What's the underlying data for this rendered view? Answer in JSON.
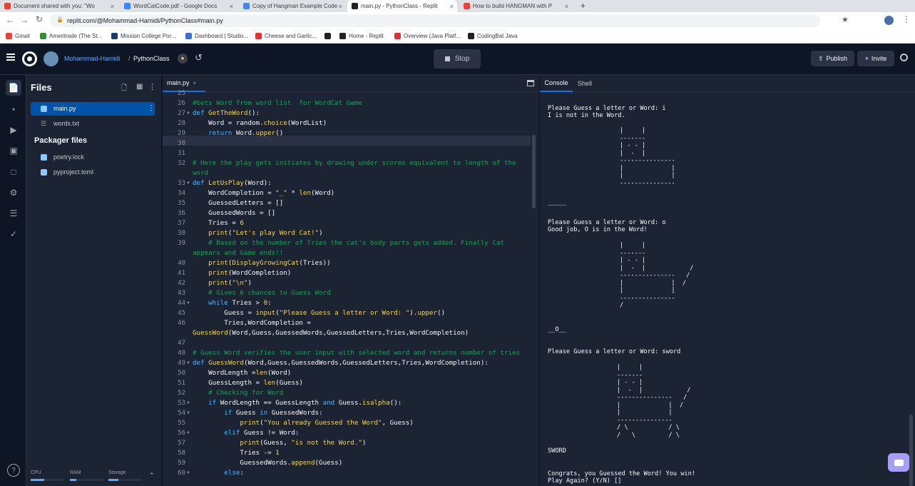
{
  "browser": {
    "tabs": [
      {
        "label": "Document shared with you: \"Wo",
        "color": "#ea4335"
      },
      {
        "label": "WordCatCode.pdf - Google Docs",
        "color": "#4285f4"
      },
      {
        "label": "Copy of Hangman Example Code",
        "color": "#4285f4"
      },
      {
        "label": "main.py - PythonClass - Replit",
        "color": "#222"
      },
      {
        "label": "How to build HANGMAN with P",
        "color": "#ea4335"
      }
    ],
    "new_tab": "+",
    "url": "replit.com/@Mohammad-Hamidi/PythonClass#main.py",
    "bookmarks": [
      {
        "label": "Gmail",
        "color": "#ea4335"
      },
      {
        "label": "Ameritrade (The St...",
        "color": "#3a8a3a"
      },
      {
        "label": "Mission College Por...",
        "color": "#1a3a6e"
      },
      {
        "label": "Dashboard | Studio...",
        "color": "#3b6fd0"
      },
      {
        "label": "Cheese and Garlic...",
        "color": "#d33"
      },
      {
        "label": "",
        "color": "#222"
      },
      {
        "label": "Home - Replit",
        "color": "#222"
      },
      {
        "label": "Overview (Java Platf...",
        "color": "#d33"
      },
      {
        "label": "CodingBat Java",
        "color": "#222"
      }
    ]
  },
  "replit": {
    "user": "Mohammad-Hamidi",
    "separator": "/",
    "repl": "PythonClass",
    "stop_label": "Stop",
    "publish_label": "Publish",
    "invite_label": "Invite"
  },
  "files_panel": {
    "title": "Files",
    "items": [
      {
        "label": "main.py"
      },
      {
        "label": "words.txt"
      }
    ],
    "packager_title": "Packager files",
    "packager_items": [
      {
        "label": "poetry.lock"
      },
      {
        "label": "pyproject.toml"
      }
    ],
    "resources": {
      "cpu": "CPU",
      "ram": "RAM",
      "storage": "Storage",
      "cpu_level": 0.4,
      "ram_level": 0.2,
      "storage_level": 0.3
    }
  },
  "editor": {
    "tab_label": "main.py",
    "tab_close": "×",
    "lines": [
      {
        "n": "25",
        "fold": false,
        "html": ""
      },
      {
        "n": "26",
        "fold": false,
        "html": "<span class=\"cm\">#Gets Word from word list  for WordCat Game</span>"
      },
      {
        "n": "27",
        "fold": true,
        "html": "<span class=\"kw\">def</span> <span class=\"fn\">GetTheWord</span>():"
      },
      {
        "n": "28",
        "fold": false,
        "html": "    Word = random.<span class=\"fn\">choice</span>(WordList)"
      },
      {
        "n": "29",
        "fold": false,
        "html": "    <span class=\"kw\">return</span> Word.<span class=\"fn\">upper</span>()"
      },
      {
        "n": "30",
        "fold": false,
        "html": ""
      },
      {
        "n": "31",
        "fold": false,
        "html": ""
      },
      {
        "n": "32",
        "fold": false,
        "html": "<span class=\"cm\"># Here the play gets initiates by drawing under scores equivalent to length of the</span>"
      },
      {
        "n": "",
        "fold": false,
        "html": "<span class=\"cm\">word</span>"
      },
      {
        "n": "33",
        "fold": true,
        "html": "<span class=\"kw\">def</span> <span class=\"fn\">LetUsPlay</span>(Word):"
      },
      {
        "n": "34",
        "fold": false,
        "html": "    WordCompletion = <span class=\"st\">\"_\"</span> * <span class=\"fn\">len</span>(Word)"
      },
      {
        "n": "35",
        "fold": false,
        "html": "    GuessedLetters = []"
      },
      {
        "n": "36",
        "fold": false,
        "html": "    GuessedWords = []"
      },
      {
        "n": "37",
        "fold": false,
        "html": "    Tries = <span class=\"nm\">6</span>"
      },
      {
        "n": "38",
        "fold": false,
        "html": "    <span class=\"fn\">print</span>(<span class=\"st\">\"Let's play Word Cat!\"</span>)"
      },
      {
        "n": "39",
        "fold": false,
        "html": "    <span class=\"cm\"># Based on the number of Tries the cat's body parts gets added. Finally Cat</span>"
      },
      {
        "n": "",
        "fold": false,
        "html": "<span class=\"cm\">appears and Game ends!!</span>"
      },
      {
        "n": "40",
        "fold": false,
        "html": "    <span class=\"fn\">print</span>(<span class=\"fn\">DisplayGrowingCat</span>(Tries))"
      },
      {
        "n": "41",
        "fold": false,
        "html": "    <span class=\"fn\">print</span>(WordCompletion)"
      },
      {
        "n": "42",
        "fold": false,
        "html": "    <span class=\"fn\">print</span>(<span class=\"st\">\"\\n\"</span>)"
      },
      {
        "n": "43",
        "fold": false,
        "html": "    <span class=\"cm\"># Gives 6 chances to Guess Word</span>"
      },
      {
        "n": "44",
        "fold": true,
        "html": "    <span class=\"kw\">while</span> Tries > <span class=\"nm\">0</span>:"
      },
      {
        "n": "45",
        "fold": false,
        "html": "        Guess = <span class=\"fn\">input</span>(<span class=\"st\">\"Please Guess a letter or Word: \"</span>).<span class=\"fn\">upper</span>()"
      },
      {
        "n": "46",
        "fold": false,
        "html": "        Tries,WordCompletion ="
      },
      {
        "n": "",
        "fold": false,
        "html": "<span class=\"fn\">GuessWord</span>(Word,Guess,GuessedWords,GuessedLetters,Tries,WordCompletion)"
      },
      {
        "n": "47",
        "fold": false,
        "html": ""
      },
      {
        "n": "48",
        "fold": false,
        "html": "<span class=\"cm\"># Guess Word verifies the user input with selected word and returns number of tries</span>"
      },
      {
        "n": "49",
        "fold": true,
        "html": "<span class=\"kw\">def</span> <span class=\"fn\">GuessWord</span>(Word,Guess,GuessedWords,GuessedLetters,Tries,WordCompletion):"
      },
      {
        "n": "50",
        "fold": false,
        "html": "    WordLength =<span class=\"fn\">len</span>(Word)"
      },
      {
        "n": "51",
        "fold": false,
        "html": "    GuessLength = <span class=\"fn\">len</span>(Guess)"
      },
      {
        "n": "52",
        "fold": false,
        "html": "    <span class=\"cm\"># Checking for Word</span>"
      },
      {
        "n": "53",
        "fold": true,
        "html": "    <span class=\"kw\">if</span> WordLength == GuessLength <span class=\"kw\">and</span> Guess.<span class=\"fn\">isalpha</span>():"
      },
      {
        "n": "54",
        "fold": true,
        "html": "        <span class=\"kw\">if</span> Guess <span class=\"kw\">in</span> GuessedWords:"
      },
      {
        "n": "55",
        "fold": false,
        "html": "            <span class=\"fn\">print</span>(<span class=\"st\">\"You already Guessed the Word\"</span>, Guess)"
      },
      {
        "n": "56",
        "fold": true,
        "html": "        <span class=\"kw\">elif</span> Guess != Word:"
      },
      {
        "n": "57",
        "fold": false,
        "html": "            <span class=\"fn\">print</span>(Guess, <span class=\"st\">\"is not the Word.\"</span>)"
      },
      {
        "n": "58",
        "fold": false,
        "html": "            Tries -= <span class=\"nm\">1</span>"
      },
      {
        "n": "59",
        "fold": false,
        "html": "            GuessedWords.<span class=\"fn\">append</span>(Guess)"
      },
      {
        "n": "60",
        "fold": true,
        "html": "        <span class=\"kw\">else</span>:"
      }
    ]
  },
  "console": {
    "tab_console": "Console",
    "tab_shell": "Shell",
    "lines": [
      "Please Guess a letter or Word: i",
      "I is not in the Word.",
      "_____",
      "Please Guess a letter or Word: o",
      "Good job, O is in the Word!",
      "__O__",
      "Please Guess a letter or Word: sword",
      "SWORD",
      "Congrats, you Guessed the Word! You win!",
      "Play Again? (Y/N) []"
    ],
    "art1": "|     |\n-------\n| - - |\n|  -  |\n---------------\n|             |\n|             |\n---------------",
    "art2": "|     |\n-------\n| - - |\n|  -  |            /\n---------------   /\n|             |  /\n|             |\n---------------\n/",
    "art3": "|     |\n-------\n| - - |\n|  -  |            /\n---------------   /\n|             |  /\n|             |\n---------------\n/ \\           / \\\n/   \\         / \\"
  }
}
